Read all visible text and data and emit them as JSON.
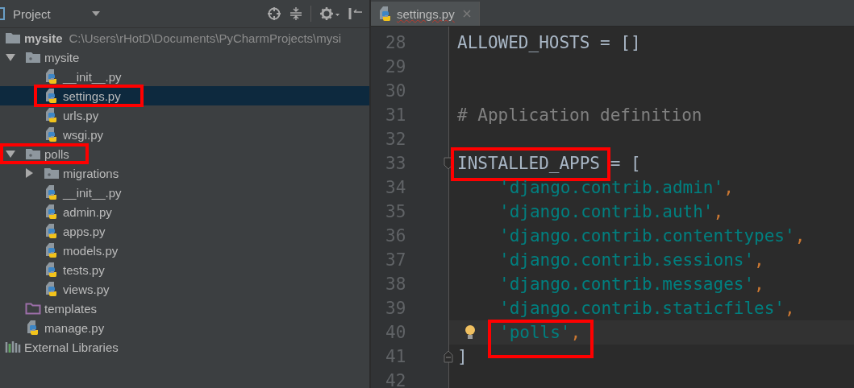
{
  "project_panel": {
    "title": "Project"
  },
  "tree": [
    {
      "kind": "root",
      "name": "mysite",
      "path": "C:\\Users\\rHotD\\Documents\\PyCharmProjects\\mysi",
      "selected": false,
      "annotated": false
    },
    {
      "kind": "package",
      "name": "mysite",
      "expanded": true,
      "selected": false,
      "annotated": false,
      "children": [
        {
          "kind": "python",
          "name": "__init__.py",
          "selected": false,
          "annotated": false
        },
        {
          "kind": "python",
          "name": "settings.py",
          "selected": true,
          "annotated": true
        },
        {
          "kind": "python",
          "name": "urls.py",
          "selected": false,
          "annotated": false
        },
        {
          "kind": "python",
          "name": "wsgi.py",
          "selected": false,
          "annotated": false
        }
      ]
    },
    {
      "kind": "package",
      "name": "polls",
      "expanded": true,
      "selected": false,
      "annotated": true,
      "children": [
        {
          "kind": "package",
          "name": "migrations",
          "expanded": false,
          "selected": false,
          "annotated": false
        },
        {
          "kind": "python",
          "name": "__init__.py",
          "selected": false,
          "annotated": false
        },
        {
          "kind": "python",
          "name": "admin.py",
          "selected": false,
          "annotated": false
        },
        {
          "kind": "python",
          "name": "apps.py",
          "selected": false,
          "annotated": false
        },
        {
          "kind": "python",
          "name": "models.py",
          "selected": false,
          "annotated": false
        },
        {
          "kind": "python",
          "name": "tests.py",
          "selected": false,
          "annotated": false
        },
        {
          "kind": "python",
          "name": "views.py",
          "selected": false,
          "annotated": false
        }
      ]
    },
    {
      "kind": "templates",
      "name": "templates",
      "selected": false,
      "annotated": false
    },
    {
      "kind": "python",
      "name": "manage.py",
      "selected": false,
      "annotated": false
    },
    {
      "kind": "libraries",
      "name": "External Libraries",
      "selected": false,
      "annotated": false
    }
  ],
  "tabs": [
    {
      "label": "settings.py",
      "selected": true
    }
  ],
  "code_lines": [
    {
      "number": "28",
      "kind": "code",
      "text": "ALLOWED_HOSTS = []"
    },
    {
      "number": "29",
      "kind": "blank"
    },
    {
      "number": "30",
      "kind": "blank"
    },
    {
      "number": "31",
      "kind": "comment",
      "text": "# Application definition"
    },
    {
      "number": "32",
      "kind": "blank"
    },
    {
      "number": "33",
      "kind": "code",
      "text": "INSTALLED_APPS",
      "rest": " = [",
      "fold_start": true,
      "annotated": true
    },
    {
      "number": "34",
      "kind": "item",
      "text": "'django.contrib.admin'",
      "trail": ","
    },
    {
      "number": "35",
      "kind": "item",
      "text": "'django.contrib.auth'",
      "trail": ","
    },
    {
      "number": "36",
      "kind": "item",
      "text": "'django.contrib.contenttypes'",
      "trail": ","
    },
    {
      "number": "37",
      "kind": "item",
      "text": "'django.contrib.sessions'",
      "trail": ","
    },
    {
      "number": "38",
      "kind": "item",
      "text": "'django.contrib.messages'",
      "trail": ","
    },
    {
      "number": "39",
      "kind": "item",
      "text": "'django.contrib.staticfiles'",
      "trail": ","
    },
    {
      "number": "40",
      "kind": "item",
      "text": "'polls'",
      "trail": ",",
      "current": true,
      "bulb": true,
      "annotated": true
    },
    {
      "number": "41",
      "kind": "code",
      "text": "]",
      "fold_end": true
    },
    {
      "number": "42",
      "kind": "blank"
    }
  ]
}
